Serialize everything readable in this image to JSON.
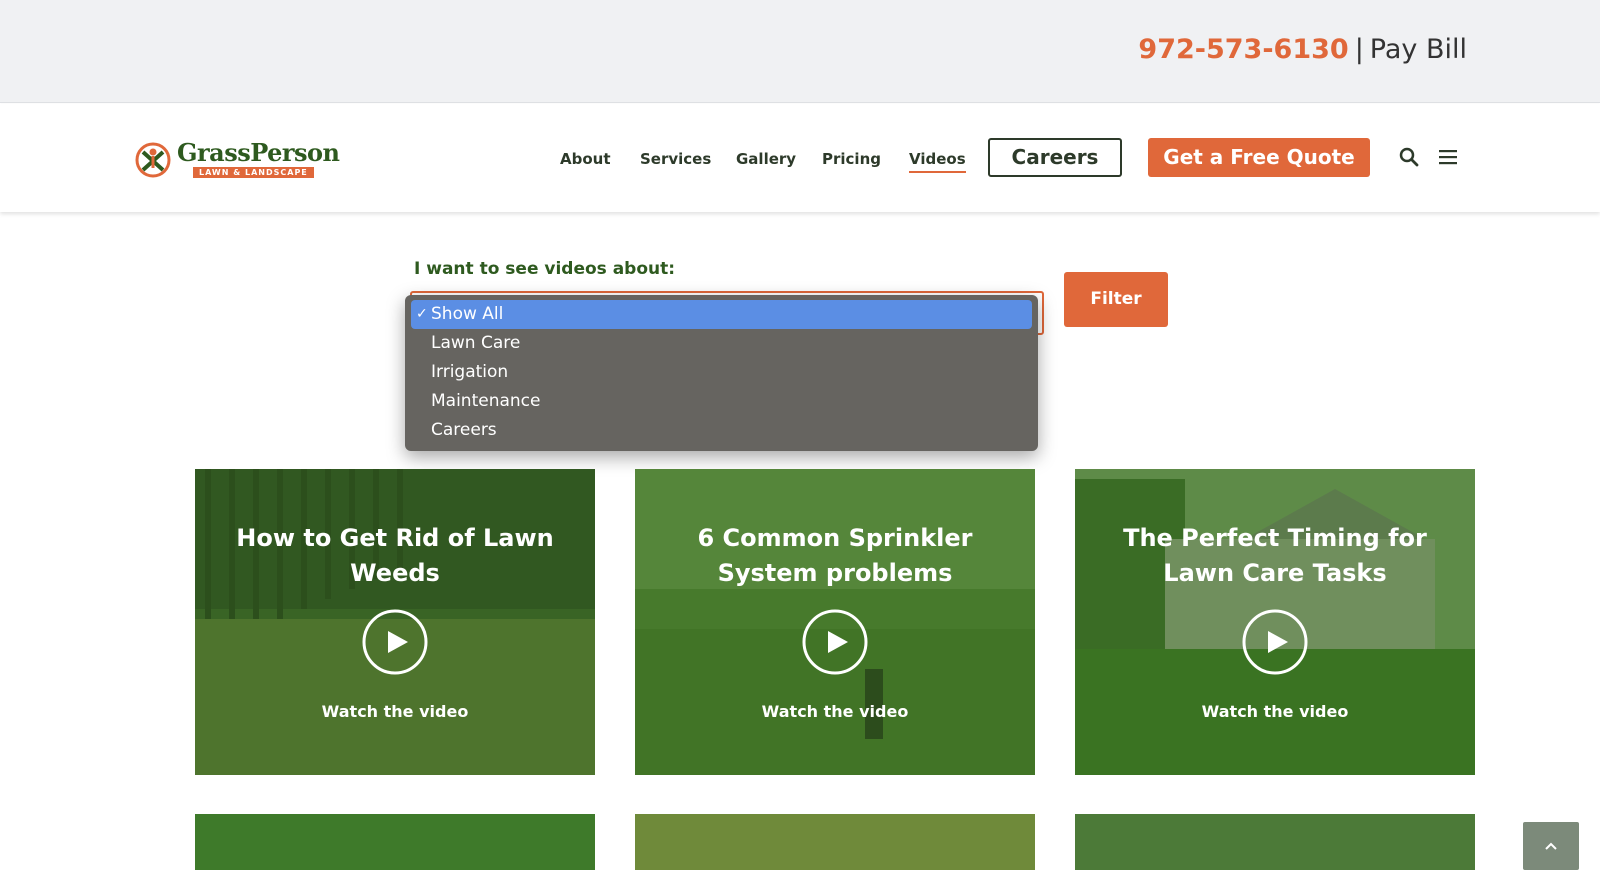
{
  "topbar": {
    "phone": "972-573-6130",
    "separator": "|",
    "pay_bill": "Pay Bill"
  },
  "logo": {
    "wordmark": "GrassPerson",
    "tagline": "LAWN & LANDSCAPE"
  },
  "nav": {
    "items": [
      {
        "label": "About"
      },
      {
        "label": "Services"
      },
      {
        "label": "Gallery"
      },
      {
        "label": "Pricing"
      },
      {
        "label": "Videos",
        "active": true
      }
    ],
    "careers_label": "Careers",
    "quote_label": "Get a Free Quote",
    "search_icon": "search-icon",
    "menu_icon": "hamburger-menu-icon"
  },
  "filter": {
    "label": "I want to see videos about:",
    "selected": "Show All",
    "options": [
      "Show All",
      "Lawn Care",
      "Irrigation",
      "Maintenance",
      "Careers"
    ],
    "button_label": "Filter"
  },
  "videos": [
    {
      "title": "How to Get Rid of Lawn Weeds",
      "cta": "Watch the video"
    },
    {
      "title": "6 Common Sprinkler System problems",
      "cta": "Watch the video"
    },
    {
      "title": "The Perfect Timing for Lawn Care Tasks",
      "cta": "Watch the video"
    }
  ],
  "colors": {
    "accent": "#e0683a",
    "brand_green": "#2e5a1f",
    "dropdown_bg": "#666460",
    "dropdown_selected": "#5b8ee4"
  },
  "scroll_top_icon": "chevron-up-icon"
}
